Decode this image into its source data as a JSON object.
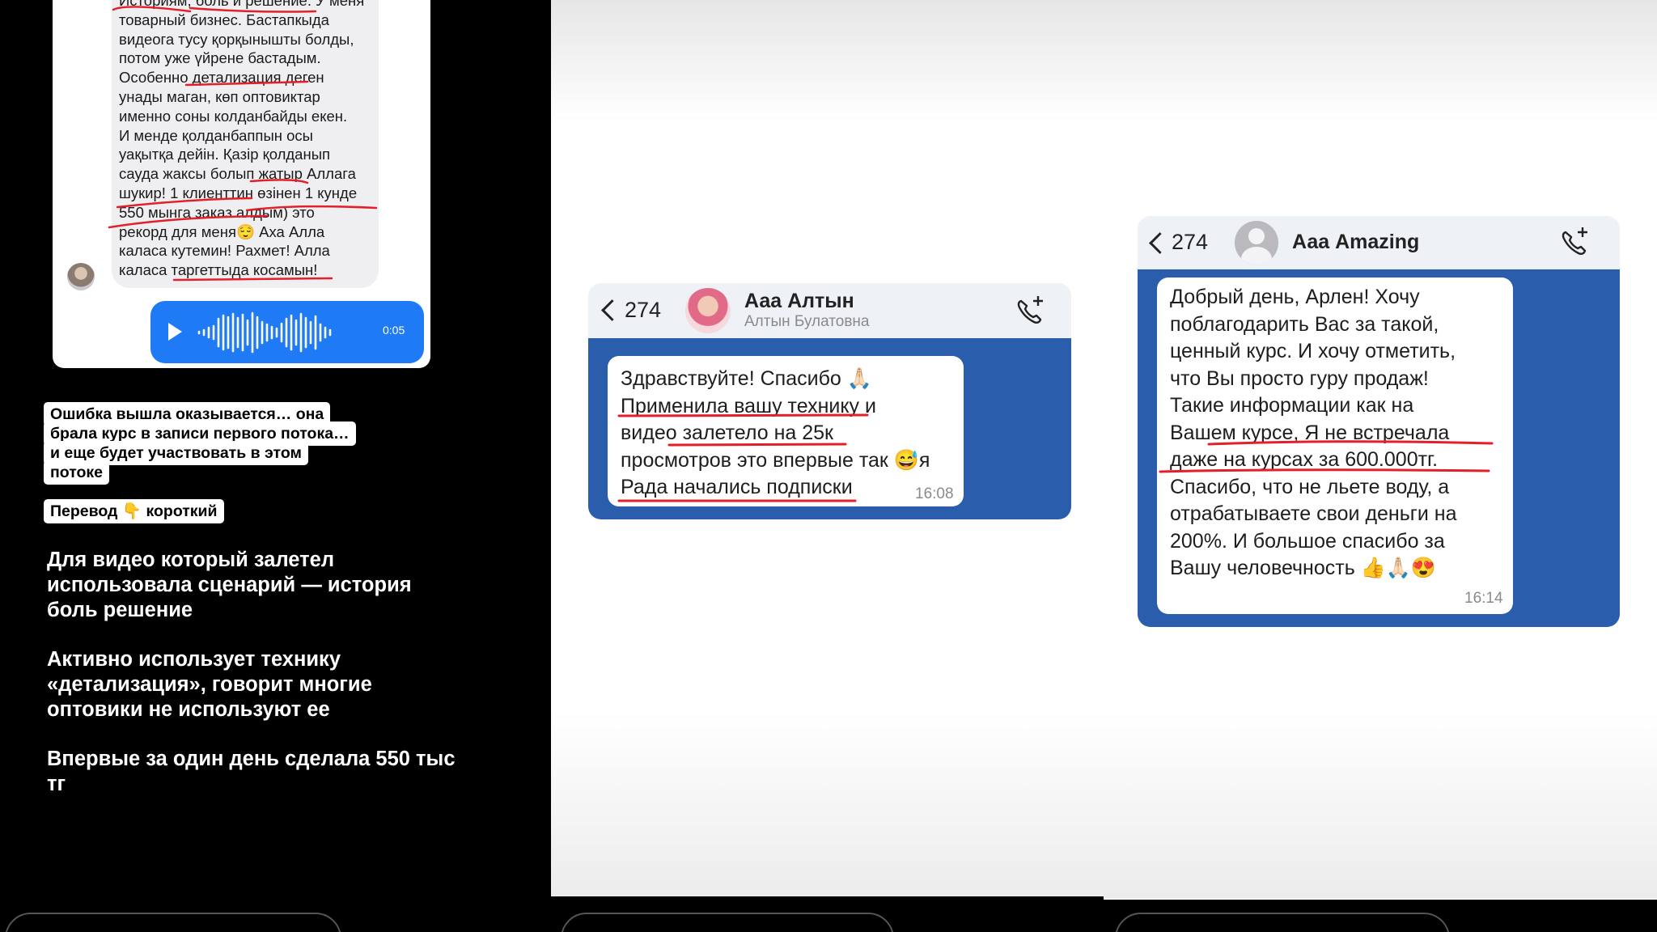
{
  "panel1": {
    "message_lines": [
      "Историям, боль и решение. У меня",
      "товарный бизнес. Бастапкыда",
      "видеога тусу қорқынышты болды,",
      "потом уже үйрене бастадым.",
      "Особенно детализация деген",
      "унады маган, көп оптовиктар",
      "именно соны колданбайды екен.",
      "И менде қолданбаппын осы",
      "уақытқа дейін. Қазір қолданып",
      "сауда жаксы болып жатыр Аллага",
      "шукир! 1 клиенттин өзінен 1 кунде",
      "550 мынга заказ алдым) это",
      "рекорд для меня😌 Аха Алла",
      "каласа кутемин! Рахмет! Алла",
      "каласа таргеттыда косамын!"
    ],
    "voice_duration": "0:05",
    "tag1_lines": [
      "Ошибка вышла оказывается… она",
      "брала курс в записи первого потока…",
      "и еще будет участвовать в этом",
      "потоке"
    ],
    "tag2": "Перевод 👇 короткий",
    "paragraphs": [
      "Для видео который залетел использовала сценарий — история боль решение",
      "Активно использует технику «детализация», говорит многие оптовики не используют ее",
      "Впервые за один день сделала 550 тыс тг"
    ]
  },
  "panel2": {
    "count": "274",
    "contact_name": "Ааа Алтын",
    "contact_sub": "Алтын Булатовна",
    "message_lines": [
      "Здравствуйте! Спасибо 🙏🏻",
      "Применила вашу технику и",
      "видео залетело на 25к",
      "просмотров это впервые так 😅я",
      "Рада начались подписки"
    ],
    "time": "16:08"
  },
  "panel3": {
    "count": "274",
    "contact_name": "Ааа Amazing",
    "message_lines": [
      "Добрый день, Арлен! Хочу",
      "поблагодарить Вас за такой,",
      "ценный курс. И хочу отметить,",
      "что Вы просто гуру продаж!",
      "Такие информации как на",
      "Вашем курсе, Я не встречала",
      "даже на курсах за 600.000тг.",
      "Спасибо, что не льете воду, а",
      "отрабатываете свои деньги на",
      "200%. И большое спасибо за",
      "Вашу человечность 👍🙏🏻😍"
    ],
    "time": "16:14"
  },
  "colors": {
    "wa_blue": "#2a5dac",
    "voice_blue": "#1e7bf5",
    "underline_red": "#e3202a"
  }
}
